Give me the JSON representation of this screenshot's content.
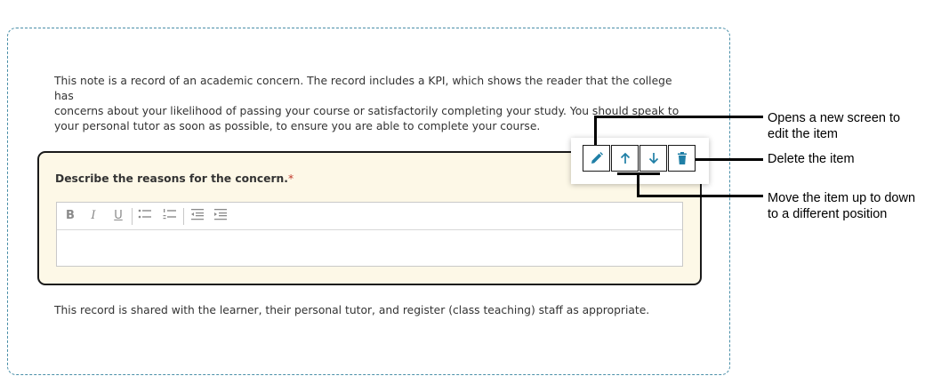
{
  "form": {
    "intro_line1": "This note is a record of an academic concern. The record includes a KPI, which shows the reader that the college has",
    "intro_line2": "concerns about your likelihood of passing your course or satisfactorily completing your study. You should speak to",
    "intro_line3": "your personal tutor as soon as possible, to ensure you are able to complete your course.",
    "question_label": "Describe the reasons for the concern.",
    "required_marker": "*",
    "footer": "This record is shared with the learner, their personal tutor, and register (class teaching) staff as appropriate."
  },
  "editor_toolbar": {
    "bold": "B",
    "italic": "I",
    "underline": "U",
    "icons": [
      "bullet-list-icon",
      "numbered-list-icon",
      "outdent-icon",
      "indent-icon"
    ]
  },
  "item_toolbar": {
    "icons": [
      "pencil-icon",
      "arrow-up-icon",
      "arrow-down-icon",
      "trash-icon"
    ],
    "icon_color": "#1f7fa6"
  },
  "callouts": {
    "edit_line1": "Opens a new screen to",
    "edit_line2": "edit the item",
    "delete": "Delete the item",
    "move_line1": "Move the item up to down",
    "move_line2": "to a different position"
  },
  "colors": {
    "frame_border": "#4a8fa8",
    "card_background": "#fdf8e7",
    "required": "#c0392b"
  }
}
